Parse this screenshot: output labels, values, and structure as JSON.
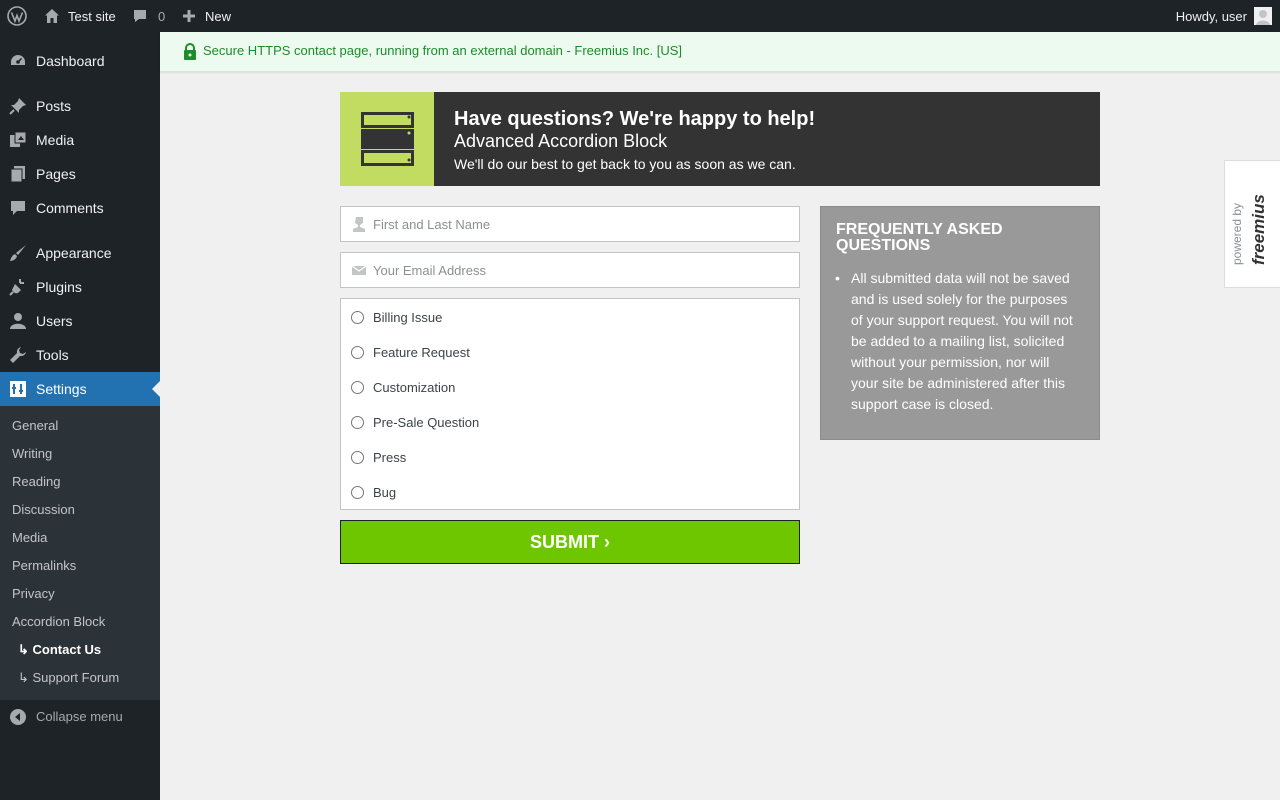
{
  "adminbar": {
    "site_name": "Test site",
    "comments_count": "0",
    "new_label": "New",
    "greeting": "Howdy, user"
  },
  "sidebar": {
    "items": [
      {
        "label": "Dashboard",
        "icon": "dashboard-icon"
      },
      {
        "label": "Posts",
        "icon": "pin-icon"
      },
      {
        "label": "Media",
        "icon": "media-icon"
      },
      {
        "label": "Pages",
        "icon": "pages-icon"
      },
      {
        "label": "Comments",
        "icon": "comment-icon"
      },
      {
        "label": "Appearance",
        "icon": "brush-icon"
      },
      {
        "label": "Plugins",
        "icon": "plugin-icon"
      },
      {
        "label": "Users",
        "icon": "user-icon"
      },
      {
        "label": "Tools",
        "icon": "wrench-icon"
      },
      {
        "label": "Settings",
        "icon": "settings-icon"
      }
    ],
    "active": "Settings",
    "submenu": [
      "General",
      "Writing",
      "Reading",
      "Discussion",
      "Media",
      "Permalinks",
      "Privacy",
      "Accordion Block",
      "↳ Contact Us",
      "↳ Support Forum"
    ],
    "current_submenu": "↳ Contact Us",
    "collapse_label": "Collapse menu"
  },
  "notice": {
    "text": "Secure HTTPS contact page, running from an external domain - Freemius Inc. [US]"
  },
  "header": {
    "title": "Have questions? We're happy to help!",
    "subtitle": "Advanced Accordion Block",
    "description": "We'll do our best to get back to you as soon as we can."
  },
  "form": {
    "name_placeholder": "First and Last Name",
    "email_placeholder": "Your Email Address",
    "options": [
      "Billing Issue",
      "Feature Request",
      "Customization",
      "Pre-Sale Question",
      "Press",
      "Bug"
    ],
    "submit_label": "SUBMIT ›"
  },
  "faq": {
    "title": "FREQUENTLY ASKED QUESTIONS",
    "items": [
      "All submitted data will not be saved and is used solely for the purposes of your support request. You will not be added to a mailing list, solicited without your permission, nor will your site be administered after this support case is closed."
    ]
  },
  "powered": {
    "prefix": "powered by",
    "brand": "freemius"
  },
  "colors": {
    "adminbar": "#1d2327",
    "accent": "#2271b1",
    "submit": "#6ec600",
    "header_icon_bg": "#c2dc62",
    "notice_bg": "#edfaef"
  }
}
